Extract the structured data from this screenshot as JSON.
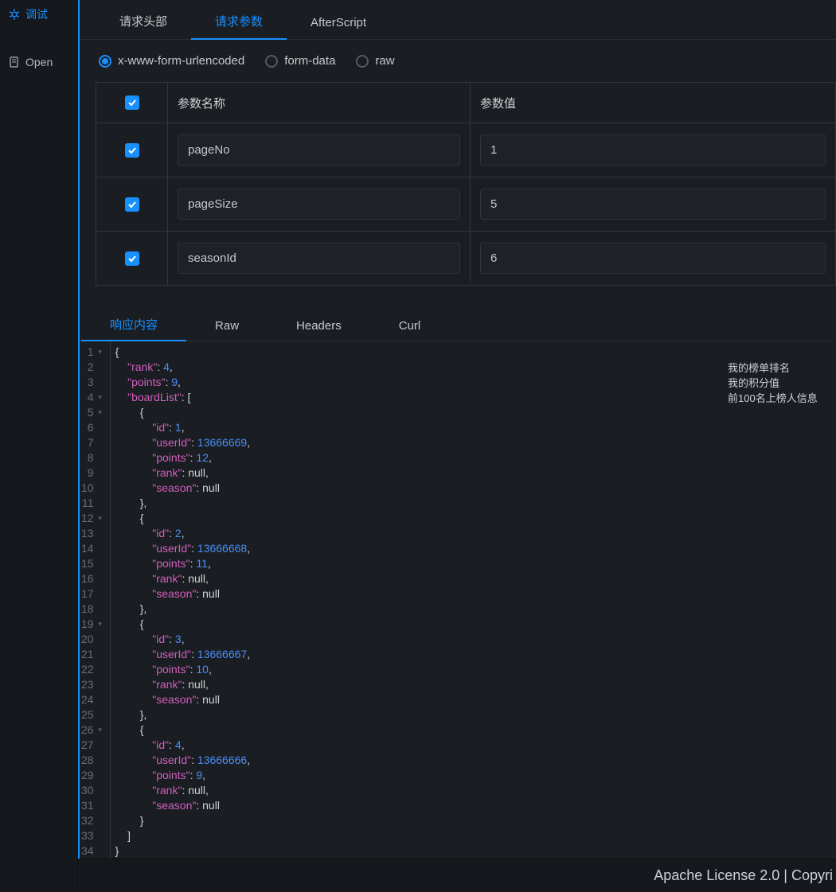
{
  "sidebar": {
    "debug_label": "调试",
    "open_label": "Open"
  },
  "request_tabs": {
    "headers": "请求头部",
    "params": "请求参数",
    "afterscript": "AfterScript"
  },
  "body_types": {
    "urlencoded": "x-www-form-urlencoded",
    "formdata": "form-data",
    "raw": "raw"
  },
  "param_table": {
    "header_name": "参数名称",
    "header_value": "参数值",
    "rows": [
      {
        "checked": true,
        "name": "pageNo",
        "value": "1"
      },
      {
        "checked": true,
        "name": "pageSize",
        "value": "5"
      },
      {
        "checked": true,
        "name": "seasonId",
        "value": "6"
      }
    ]
  },
  "response_tabs": {
    "body": "响应内容",
    "raw": "Raw",
    "headers": "Headers",
    "curl": "Curl"
  },
  "annotations": {
    "rank": "我的榜单排名",
    "points": "我的积分值",
    "boardlist": "前100名上榜人信息"
  },
  "response_json": {
    "rank": 4,
    "points": 9,
    "boardList": [
      {
        "id": 1,
        "userId": 13666669,
        "points": 12,
        "rank": null,
        "season": null
      },
      {
        "id": 2,
        "userId": 13666668,
        "points": 11,
        "rank": null,
        "season": null
      },
      {
        "id": 3,
        "userId": 13666667,
        "points": 10,
        "rank": null,
        "season": null
      },
      {
        "id": 4,
        "userId": 13666666,
        "points": 9,
        "rank": null,
        "season": null
      }
    ]
  },
  "footer_text": "Apache License 2.0 | Copyri"
}
